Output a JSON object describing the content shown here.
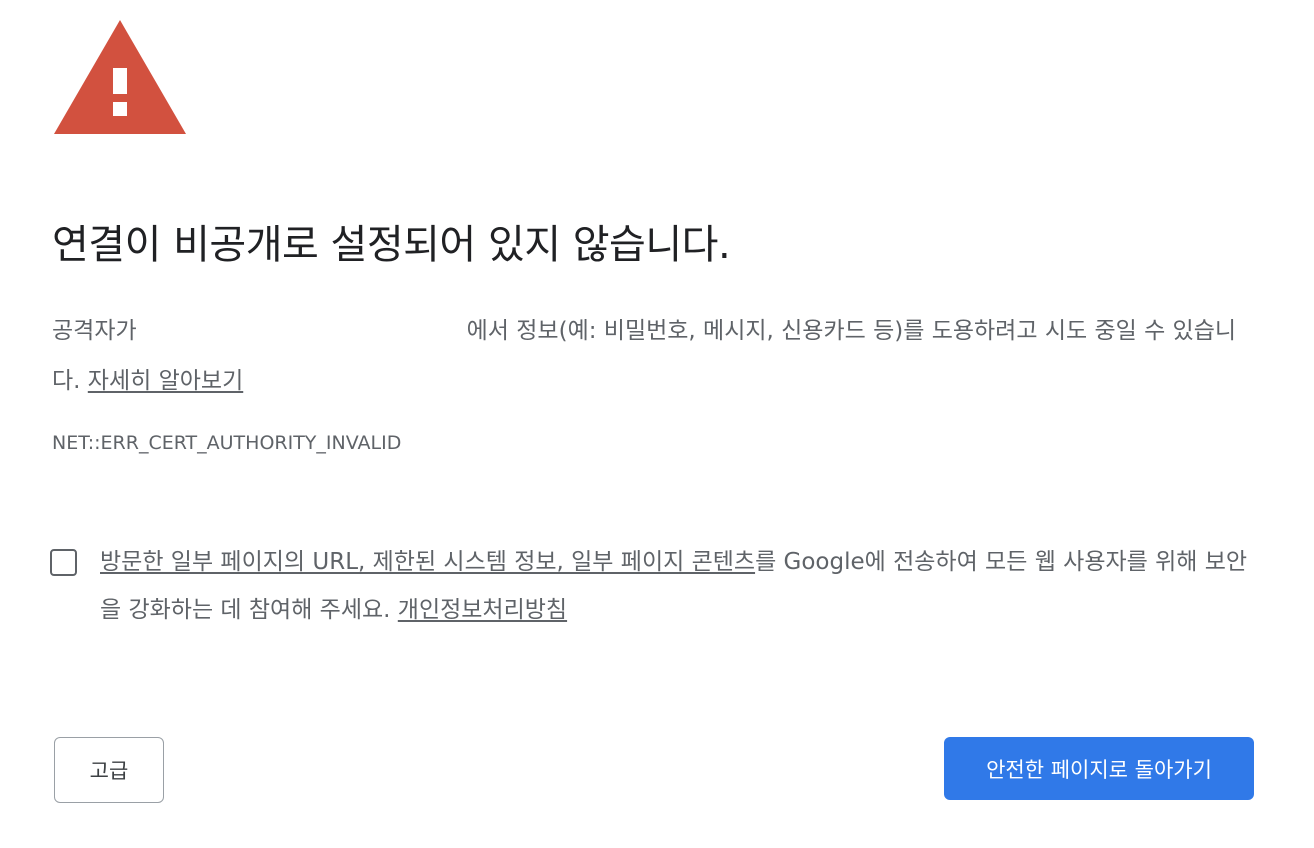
{
  "icon": {
    "name": "warning-triangle-icon",
    "color": "#d2513f"
  },
  "title": "연결이 비공개로 설정되어 있지 않습니다.",
  "explanation": {
    "prefix": "공격자가",
    "suffix": "에서 정보(예: 비밀번호, 메시지, 신용카드 등)를 도용하려고 시도 중일 수 있습니다.",
    "learn_more_link": "자세히 알아보기"
  },
  "error_code": "NET::ERR_CERT_AUTHORITY_INVALID",
  "optin": {
    "checked": false,
    "link_text": "방문한 일부 페이지의 URL, 제한된 시스템 정보, 일부 페이지 콘텐츠",
    "text": "를 Google에 전송하여 모든 웹 사용자를 위해 보안을 강화하는 데 참여해 주세요.",
    "privacy_link": "개인정보처리방침"
  },
  "buttons": {
    "advanced": "고급",
    "back_to_safety": "안전한 페이지로 돌아가기"
  },
  "colors": {
    "primary_button": "#3079e8",
    "warning": "#d2513f",
    "text_secondary": "#5f6368"
  }
}
